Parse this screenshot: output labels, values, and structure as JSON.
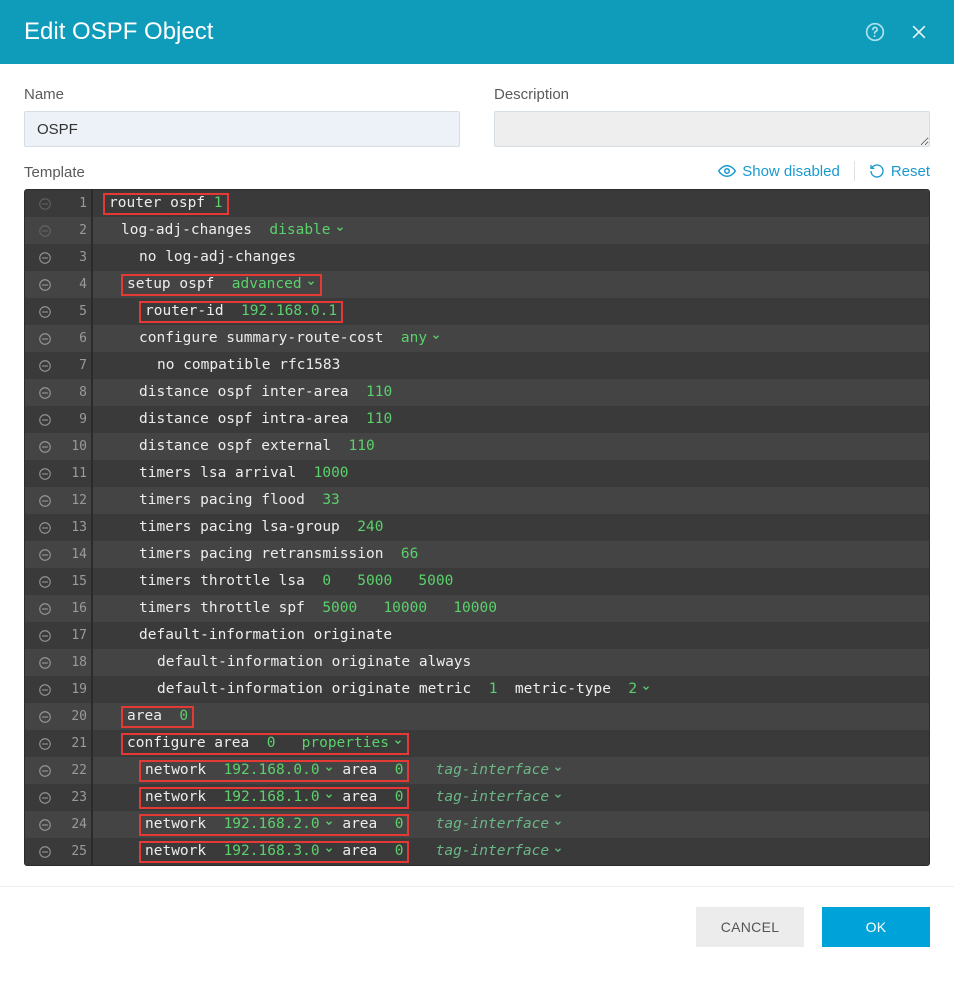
{
  "header": {
    "title": "Edit OSPF Object"
  },
  "form": {
    "name_label": "Name",
    "name_value": "OSPF",
    "desc_label": "Description",
    "desc_value": ""
  },
  "template": {
    "label": "Template",
    "show_disabled": "Show disabled",
    "reset": "Reset"
  },
  "lines": [
    {
      "n": 1,
      "indent": 0,
      "hilite": true,
      "dim": true,
      "segs": [
        [
          "t",
          "router ospf "
        ],
        [
          "v",
          "1"
        ]
      ]
    },
    {
      "n": 2,
      "indent": 1,
      "hilite": false,
      "dim": true,
      "segs": [
        [
          "t",
          "log-adj-changes  "
        ],
        [
          "v",
          "disable"
        ],
        [
          "c",
          ""
        ]
      ]
    },
    {
      "n": 3,
      "indent": 2,
      "hilite": false,
      "dim": false,
      "segs": [
        [
          "t",
          "no log-adj-changes"
        ]
      ]
    },
    {
      "n": 4,
      "indent": 1,
      "hilite": true,
      "dim": false,
      "segs": [
        [
          "t",
          "setup ospf  "
        ],
        [
          "v",
          "advanced"
        ],
        [
          "c",
          ""
        ]
      ]
    },
    {
      "n": 5,
      "indent": 2,
      "hilite": true,
      "dim": false,
      "segs": [
        [
          "t",
          "router-id  "
        ],
        [
          "v",
          "192.168.0.1"
        ]
      ]
    },
    {
      "n": 6,
      "indent": 2,
      "hilite": false,
      "dim": false,
      "segs": [
        [
          "t",
          "configure summary-route-cost  "
        ],
        [
          "v",
          "any"
        ],
        [
          "c",
          ""
        ]
      ]
    },
    {
      "n": 7,
      "indent": 3,
      "hilite": false,
      "dim": false,
      "segs": [
        [
          "t",
          "no compatible rfc1583"
        ]
      ]
    },
    {
      "n": 8,
      "indent": 2,
      "hilite": false,
      "dim": false,
      "segs": [
        [
          "t",
          "distance ospf inter-area  "
        ],
        [
          "v",
          "110"
        ]
      ]
    },
    {
      "n": 9,
      "indent": 2,
      "hilite": false,
      "dim": false,
      "segs": [
        [
          "t",
          "distance ospf intra-area  "
        ],
        [
          "v",
          "110"
        ]
      ]
    },
    {
      "n": 10,
      "indent": 2,
      "hilite": false,
      "dim": false,
      "segs": [
        [
          "t",
          "distance ospf external  "
        ],
        [
          "v",
          "110"
        ]
      ]
    },
    {
      "n": 11,
      "indent": 2,
      "hilite": false,
      "dim": false,
      "segs": [
        [
          "t",
          "timers lsa arrival  "
        ],
        [
          "v",
          "1000"
        ]
      ]
    },
    {
      "n": 12,
      "indent": 2,
      "hilite": false,
      "dim": false,
      "segs": [
        [
          "t",
          "timers pacing flood  "
        ],
        [
          "v",
          "33"
        ]
      ]
    },
    {
      "n": 13,
      "indent": 2,
      "hilite": false,
      "dim": false,
      "segs": [
        [
          "t",
          "timers pacing lsa-group  "
        ],
        [
          "v",
          "240"
        ]
      ]
    },
    {
      "n": 14,
      "indent": 2,
      "hilite": false,
      "dim": false,
      "segs": [
        [
          "t",
          "timers pacing retransmission  "
        ],
        [
          "v",
          "66"
        ]
      ]
    },
    {
      "n": 15,
      "indent": 2,
      "hilite": false,
      "dim": false,
      "segs": [
        [
          "t",
          "timers throttle lsa  "
        ],
        [
          "v",
          "0"
        ],
        [
          "t",
          "   "
        ],
        [
          "v",
          "5000"
        ],
        [
          "t",
          "   "
        ],
        [
          "v",
          "5000"
        ]
      ]
    },
    {
      "n": 16,
      "indent": 2,
      "hilite": false,
      "dim": false,
      "segs": [
        [
          "t",
          "timers throttle spf  "
        ],
        [
          "v",
          "5000"
        ],
        [
          "t",
          "   "
        ],
        [
          "v",
          "10000"
        ],
        [
          "t",
          "   "
        ],
        [
          "v",
          "10000"
        ]
      ]
    },
    {
      "n": 17,
      "indent": 2,
      "hilite": false,
      "dim": false,
      "segs": [
        [
          "t",
          "default-information originate"
        ]
      ]
    },
    {
      "n": 18,
      "indent": 3,
      "hilite": false,
      "dim": false,
      "segs": [
        [
          "t",
          "default-information originate always"
        ]
      ]
    },
    {
      "n": 19,
      "indent": 3,
      "hilite": false,
      "dim": false,
      "segs": [
        [
          "t",
          "default-information originate metric  "
        ],
        [
          "v",
          "1"
        ],
        [
          "t",
          "  metric-type  "
        ],
        [
          "v",
          "2"
        ],
        [
          "c",
          ""
        ]
      ]
    },
    {
      "n": 20,
      "indent": 1,
      "hilite": true,
      "dim": false,
      "segs": [
        [
          "t",
          "area  "
        ],
        [
          "v",
          "0"
        ]
      ]
    },
    {
      "n": 21,
      "indent": 1,
      "hilite": true,
      "dim": false,
      "segs": [
        [
          "t",
          "configure area  "
        ],
        [
          "v",
          "0"
        ],
        [
          "t",
          "   "
        ],
        [
          "v",
          "properties"
        ],
        [
          "c",
          ""
        ]
      ]
    },
    {
      "n": 22,
      "indent": 2,
      "hilite": true,
      "dim": false,
      "segs": [
        [
          "t",
          "network  "
        ],
        [
          "v",
          "192.168.0.0"
        ],
        [
          "c",
          ""
        ],
        [
          "t",
          " area  "
        ],
        [
          "v",
          "0"
        ]
      ],
      "hint": "tag-interface"
    },
    {
      "n": 23,
      "indent": 2,
      "hilite": true,
      "dim": false,
      "segs": [
        [
          "t",
          "network  "
        ],
        [
          "v",
          "192.168.1.0"
        ],
        [
          "c",
          ""
        ],
        [
          "t",
          " area  "
        ],
        [
          "v",
          "0"
        ]
      ],
      "hint": "tag-interface"
    },
    {
      "n": 24,
      "indent": 2,
      "hilite": true,
      "dim": false,
      "segs": [
        [
          "t",
          "network  "
        ],
        [
          "v",
          "192.168.2.0"
        ],
        [
          "c",
          ""
        ],
        [
          "t",
          " area  "
        ],
        [
          "v",
          "0"
        ]
      ],
      "hint": "tag-interface"
    },
    {
      "n": 25,
      "indent": 2,
      "hilite": true,
      "dim": false,
      "segs": [
        [
          "t",
          "network  "
        ],
        [
          "v",
          "192.168.3.0"
        ],
        [
          "c",
          ""
        ],
        [
          "t",
          " area  "
        ],
        [
          "v",
          "0"
        ]
      ],
      "hint": "tag-interface"
    }
  ],
  "footer": {
    "cancel": "CANCEL",
    "ok": "OK"
  }
}
